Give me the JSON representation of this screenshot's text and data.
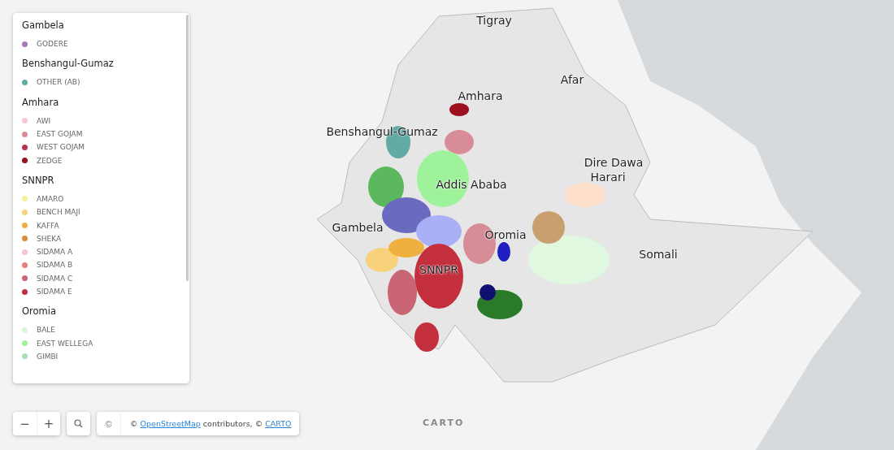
{
  "legend": {
    "groups": [
      {
        "title": "Gambela",
        "items": [
          {
            "label": "GODERE",
            "color": "#a77ab8"
          }
        ]
      },
      {
        "title": "Benshangul-Gumaz",
        "items": [
          {
            "label": "OTHER (AB)",
            "color": "#62aaa6"
          }
        ]
      },
      {
        "title": "Amhara",
        "items": [
          {
            "label": "AWI",
            "color": "#f6c9d2"
          },
          {
            "label": "EAST GOJAM",
            "color": "#d88c98"
          },
          {
            "label": "WEST GOJAM",
            "color": "#b83349"
          },
          {
            "label": "ZEDGE",
            "color": "#9c1020"
          }
        ]
      },
      {
        "title": "SNNPR",
        "items": [
          {
            "label": "AMARO",
            "color": "#f5f29a"
          },
          {
            "label": "BENCH MAJI",
            "color": "#f8d27a"
          },
          {
            "label": "KAFFA",
            "color": "#efb040"
          },
          {
            "label": "SHEKA",
            "color": "#d88d3c"
          },
          {
            "label": "SIDAMA A",
            "color": "#f6c6d0"
          },
          {
            "label": "SIDAMA B",
            "color": "#ec7c7c"
          },
          {
            "label": "SIDAMA C",
            "color": "#c96575"
          },
          {
            "label": "SIDAMA E",
            "color": "#c42f3d"
          }
        ]
      },
      {
        "title": "Oromia",
        "items": [
          {
            "label": "BALE",
            "color": "#d6f8d6"
          },
          {
            "label": "EAST WELLEGA",
            "color": "#9ef39a"
          },
          {
            "label": "GIMBI",
            "color": "#aedcb2"
          }
        ]
      }
    ]
  },
  "map": {
    "labels": [
      {
        "text": "Tigray"
      },
      {
        "text": "Afar"
      },
      {
        "text": "Amhara"
      },
      {
        "text": "Benshangul-Gumaz"
      },
      {
        "text": "Addis Ababa"
      },
      {
        "text": "Dire Dawa"
      },
      {
        "text": "Harari"
      },
      {
        "text": "Gambela"
      },
      {
        "text": "Oromia"
      },
      {
        "text": "SNNPR"
      },
      {
        "text": "Somali"
      }
    ],
    "logo": "CARTO"
  },
  "controls": {
    "zoom_out": "−",
    "zoom_in": "+",
    "attribution_toggle": "©",
    "attribution": [
      {
        "text": "© ",
        "link": false
      },
      {
        "text": "OpenStreetMap",
        "link": true
      },
      {
        "text": " contributors, © ",
        "link": false
      },
      {
        "text": "CARTO",
        "link": true
      }
    ]
  }
}
